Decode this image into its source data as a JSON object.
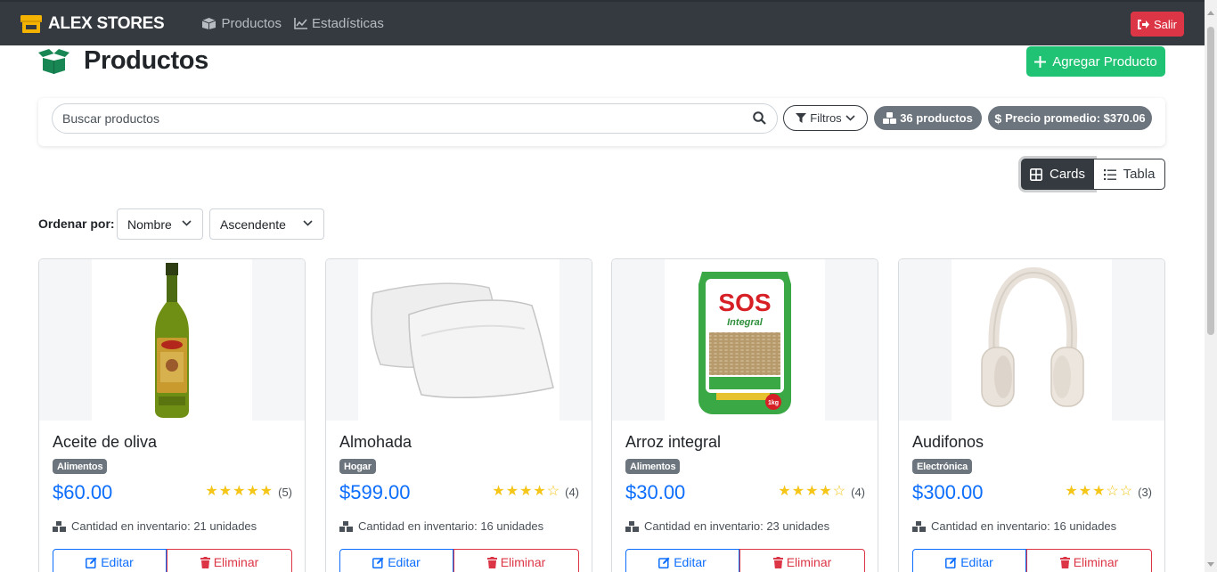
{
  "navbar": {
    "brand": "ALEX STORES",
    "links": [
      {
        "label": "Productos",
        "icon": "boxes-icon"
      },
      {
        "label": "Estadísticas",
        "icon": "chart-line-icon"
      }
    ],
    "logout_label": "Salir"
  },
  "header": {
    "title": "Productos",
    "add_label": "Agregar Producto"
  },
  "search": {
    "placeholder": "Buscar productos",
    "value": "",
    "filter_label": "Filtros",
    "count_label": "36 productos",
    "avg_label": "Precio promedio: $370.06"
  },
  "view": {
    "cards_label": "Cards",
    "table_label": "Tabla",
    "active": "cards"
  },
  "sort": {
    "label": "Ordenar por:",
    "field": "Nombre",
    "direction": "Ascendente"
  },
  "colors": {
    "navbar": "#343a40",
    "primary": "#0d6efd",
    "success": "#20c274",
    "danger": "#dc3545",
    "secondary": "#6c757d",
    "star": "#f5c518"
  },
  "products": [
    {
      "name": "Aceite de oliva",
      "category": "Alimentos",
      "price": "$60.00",
      "rating": 5,
      "reviews": "(5)",
      "stock": "Cantidad en inventario: 21 unidades",
      "edit": "Editar",
      "delete": "Eliminar",
      "image": "olive-oil-bottle"
    },
    {
      "name": "Almohada",
      "category": "Hogar",
      "price": "$599.00",
      "rating": 4,
      "reviews": "(4)",
      "stock": "Cantidad en inventario: 16 unidades",
      "edit": "Editar",
      "delete": "Eliminar",
      "image": "pillows"
    },
    {
      "name": "Arroz integral",
      "category": "Alimentos",
      "price": "$30.00",
      "rating": 4,
      "reviews": "(4)",
      "stock": "Cantidad en inventario: 23 unidades",
      "edit": "Editar",
      "delete": "Eliminar",
      "image": "rice-bag",
      "image_text": {
        "brand": "SOS",
        "sub": "Integral",
        "weight": "1kg"
      }
    },
    {
      "name": "Audifonos",
      "category": "Electrónica",
      "price": "$300.00",
      "rating": 3,
      "reviews": "(3)",
      "stock": "Cantidad en inventario: 16 unidades",
      "edit": "Editar",
      "delete": "Eliminar",
      "image": "headphones"
    }
  ]
}
